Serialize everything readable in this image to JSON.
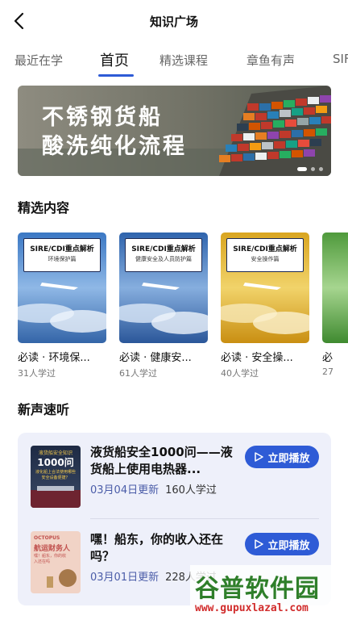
{
  "header": {
    "title": "知识广场",
    "back_icon": "chevron-left-icon"
  },
  "tabs": [
    {
      "label": "最近在学",
      "active": false
    },
    {
      "label": "首页",
      "active": true
    },
    {
      "label": "精选课程",
      "active": false
    },
    {
      "label": "章鱼有声",
      "active": false
    },
    {
      "label": "SIF",
      "active": false
    }
  ],
  "banner": {
    "line1": "不锈钢货船",
    "line2": "酸洗纯化流程",
    "slides": 3,
    "active_slide": 1
  },
  "featured": {
    "section_title": "精选内容",
    "cards": [
      {
        "cover_title": "SIRE/CDI重点解析",
        "cover_subtitle": "环境保护篇",
        "title": "必读 · 环境保...",
        "learners": "31人学过",
        "theme": "blue"
      },
      {
        "cover_title": "SIRE/CDI重点解析",
        "cover_subtitle": "健康安全及人员防护篇",
        "title": "必读 · 健康安...",
        "learners": "61人学过",
        "theme": "blue"
      },
      {
        "cover_title": "SIRE/CDI重点解析",
        "cover_subtitle": "安全操作篇",
        "title": "必读 · 安全操...",
        "learners": "40人学过",
        "theme": "gold"
      },
      {
        "cover_title": "",
        "cover_subtitle": "",
        "title": "必",
        "learners": "27",
        "theme": "green"
      }
    ]
  },
  "audio": {
    "section_title": "新声速听",
    "items": [
      {
        "thumb_line1": "液货船安全知识",
        "thumb_line2": "1000问",
        "thumb_line3": "液化船上合法使用哪些安全设备便捷？",
        "title": "液货船安全1000问——液货船上使用电热器...",
        "date": "03月04日更新",
        "learners": "160人学过",
        "button": "立即播放"
      },
      {
        "thumb_line1": "OCTOPUS",
        "thumb_line2": "航运财务人",
        "thumb_line3": "嘿！船东，你的收入还在吗",
        "title": "嘿！船东，你的收入还在吗？",
        "date": "03月01日更新",
        "learners": "228人学过",
        "button": "立即播放"
      }
    ]
  },
  "watermark": {
    "name": "谷普软件园",
    "url": "www.gupuxlazal.com"
  },
  "colors": {
    "accent": "#2e5bd6",
    "panel": "#eef0fa",
    "watermark_green": "#2f7f2a",
    "watermark_red": "#d12c2c"
  }
}
